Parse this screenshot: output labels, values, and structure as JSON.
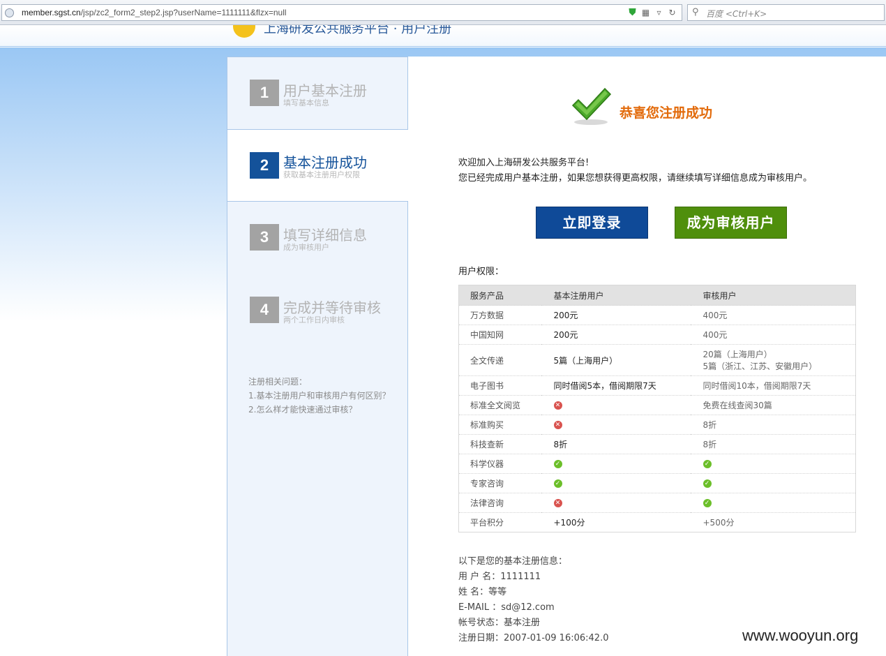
{
  "browser": {
    "url_host": "member.sgst.cn",
    "url_path": "/jsp/zc2_form2_step2.jsp?userName=1111111&flzx=null",
    "search_placeholder": "百度 <Ctrl+K>"
  },
  "header": {
    "site_title": "上海研发公共服务平台 · 用户注册"
  },
  "steps": [
    {
      "num": "1",
      "title": "用户基本注册",
      "sub": "填写基本信息"
    },
    {
      "num": "2",
      "title": "基本注册成功",
      "sub": "获取基本注册用户权限"
    },
    {
      "num": "3",
      "title": "填写详细信息",
      "sub": "成为审核用户"
    },
    {
      "num": "4",
      "title": "完成并等待审核",
      "sub": "两个工作日内审核"
    }
  ],
  "faq": {
    "title": "注册相关问题：",
    "items": [
      "1.基本注册用户和审核用户有何区别？",
      "2.怎么样才能快速通过审核？"
    ]
  },
  "main": {
    "success": "恭喜您注册成功",
    "welcome_line1": "欢迎加入上海研发公共服务平台!",
    "welcome_line2": "您已经完成用户基本注册，如果您想获得更高权限，请继续填写详细信息成为审核用户。",
    "login_button": "立即登录",
    "audit_button": "成为审核用户",
    "perm_title": "用户权限："
  },
  "table": {
    "headers": [
      "服务产品",
      "基本注册用户",
      "审核用户"
    ],
    "rows": [
      {
        "product": "万方数据",
        "basic": "200元",
        "audited": "400元"
      },
      {
        "product": "中国知网",
        "basic": "200元",
        "audited": "400元"
      },
      {
        "product": "全文传递",
        "basic": "5篇（上海用户）",
        "audited": "20篇（上海用户）",
        "audited2": "5篇（浙江、江苏、安徽用户）"
      },
      {
        "product": "电子图书",
        "basic": "同时借阅5本，借阅期限7天",
        "audited": "同时借阅10本，借阅期限7天"
      },
      {
        "product": "标准全文阅览",
        "basic_icon": "no",
        "audited": "免费在线查阅30篇"
      },
      {
        "product": "标准购买",
        "basic_icon": "no",
        "audited": "8折"
      },
      {
        "product": "科技查新",
        "basic": "8折",
        "audited": "8折"
      },
      {
        "product": "科学仪器",
        "basic_icon": "yes",
        "audited_icon": "yes"
      },
      {
        "product": "专家咨询",
        "basic_icon": "yes",
        "audited_icon": "yes"
      },
      {
        "product": "法律咨询",
        "basic_icon": "no",
        "audited_icon": "yes"
      },
      {
        "product": "平台积分",
        "basic": "+100分",
        "audited": "+500分"
      }
    ]
  },
  "reginfo": {
    "title": "以下是您的基本注册信息：",
    "username": "用 户 名：1111111",
    "name": "姓 名：等等",
    "email": "E-MAIL ：sd@12.com",
    "status": "帐号状态：基本注册",
    "date": "注册日期：2007-01-09 16:06:42.0"
  },
  "watermark": "www.wooyun.org",
  "icons": {
    "yes": "check-circle-icon",
    "no": "cross-circle-icon",
    "yes_color": "#6cbf2a",
    "no_color": "#d9534f"
  }
}
